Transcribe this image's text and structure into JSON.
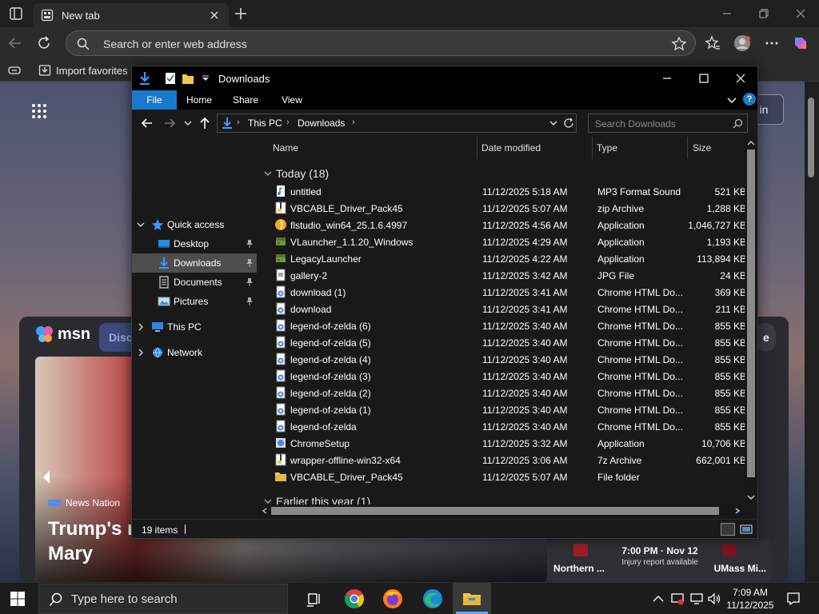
{
  "browser": {
    "tab_title": "New tab",
    "address_placeholder": "Search or enter web address",
    "favorites_import": "Import favorites"
  },
  "msn": {
    "logo_text": "msn",
    "discover_label": "Disco",
    "signin_label": "in",
    "pill_label": "e",
    "news_source": "News Nation",
    "news_headline": "Trump's n Mary",
    "sports_time": "7:00 PM · Nov 12",
    "sports_note": "Injury report available",
    "team_left": "Northern ...",
    "team_right": "UMass Mi..."
  },
  "explorer": {
    "title": "Downloads",
    "ribbon_tabs": [
      "File",
      "Home",
      "Share",
      "View"
    ],
    "breadcrumb": [
      "This PC",
      "Downloads"
    ],
    "search_placeholder": "Search Downloads",
    "nav": [
      {
        "label": "Quick access",
        "icon": "star-icon"
      },
      {
        "label": "Desktop",
        "icon": "desktop-icon",
        "pinned": true
      },
      {
        "label": "Downloads",
        "icon": "downloads-icon",
        "pinned": true,
        "selected": true
      },
      {
        "label": "Documents",
        "icon": "documents-icon",
        "pinned": true
      },
      {
        "label": "Pictures",
        "icon": "pictures-icon",
        "pinned": true
      },
      {
        "label": "This PC",
        "icon": "computer-icon"
      },
      {
        "label": "Network",
        "icon": "network-icon"
      }
    ],
    "columns": [
      "Name",
      "Date modified",
      "Type",
      "Size"
    ],
    "groups": [
      "Today (18)",
      "Earlier this year (1)"
    ],
    "files": [
      {
        "name": "untitled",
        "date": "11/12/2025 5:18 AM",
        "type": "MP3 Format Sound",
        "size": "521 KB",
        "icon": "audio"
      },
      {
        "name": "VBCABLE_Driver_Pack45",
        "date": "11/12/2025 5:07 AM",
        "type": "zip Archive",
        "size": "1,288 KB",
        "icon": "archive"
      },
      {
        "name": "flstudio_win64_25.1.6.4997",
        "date": "11/12/2025 4:56 AM",
        "type": "Application",
        "size": "1,046,727 KB",
        "icon": "flstudio"
      },
      {
        "name": "VLauncher_1.1.20_Windows",
        "date": "11/12/2025 4:29 AM",
        "type": "Application",
        "size": "1,193 KB",
        "icon": "block"
      },
      {
        "name": "LegacyLauncher",
        "date": "11/12/2025 4:22 AM",
        "type": "Application",
        "size": "113,894 KB",
        "icon": "block"
      },
      {
        "name": "gallery-2",
        "date": "11/12/2025 3:42 AM",
        "type": "JPG File",
        "size": "24 KB",
        "icon": "image"
      },
      {
        "name": "download (1)",
        "date": "11/12/2025 3:41 AM",
        "type": "Chrome HTML Do...",
        "size": "369 KB",
        "icon": "html"
      },
      {
        "name": "download",
        "date": "11/12/2025 3:41 AM",
        "type": "Chrome HTML Do...",
        "size": "211 KB",
        "icon": "html"
      },
      {
        "name": "legend-of-zelda (6)",
        "date": "11/12/2025 3:40 AM",
        "type": "Chrome HTML Do...",
        "size": "855 KB",
        "icon": "html"
      },
      {
        "name": "legend-of-zelda (5)",
        "date": "11/12/2025 3:40 AM",
        "type": "Chrome HTML Do...",
        "size": "855 KB",
        "icon": "html"
      },
      {
        "name": "legend-of-zelda (4)",
        "date": "11/12/2025 3:40 AM",
        "type": "Chrome HTML Do...",
        "size": "855 KB",
        "icon": "html"
      },
      {
        "name": "legend-of-zelda (3)",
        "date": "11/12/2025 3:40 AM",
        "type": "Chrome HTML Do...",
        "size": "855 KB",
        "icon": "html"
      },
      {
        "name": "legend-of-zelda (2)",
        "date": "11/12/2025 3:40 AM",
        "type": "Chrome HTML Do...",
        "size": "855 KB",
        "icon": "html"
      },
      {
        "name": "legend-of-zelda (1)",
        "date": "11/12/2025 3:40 AM",
        "type": "Chrome HTML Do...",
        "size": "855 KB",
        "icon": "html"
      },
      {
        "name": "legend-of-zelda",
        "date": "11/12/2025 3:40 AM",
        "type": "Chrome HTML Do...",
        "size": "855 KB",
        "icon": "html"
      },
      {
        "name": "ChromeSetup",
        "date": "11/12/2025 3:32 AM",
        "type": "Application",
        "size": "10,706 KB",
        "icon": "setup"
      },
      {
        "name": "wrapper-offline-win32-x64",
        "date": "11/12/2025 3:06 AM",
        "type": "7z Archive",
        "size": "662,001 KB",
        "icon": "archive"
      },
      {
        "name": "VBCABLE_Driver_Pack45",
        "date": "11/12/2025 5:07 AM",
        "type": "File folder",
        "size": "",
        "icon": "folder"
      }
    ],
    "status_count": "19 items"
  },
  "taskbar": {
    "search_placeholder": "Type here to search",
    "time": "7:09 AM",
    "date": "11/12/2025"
  },
  "colors": {
    "accent": "#1979ca",
    "selection": "#4d4d4d",
    "folder": "#f0c850"
  }
}
